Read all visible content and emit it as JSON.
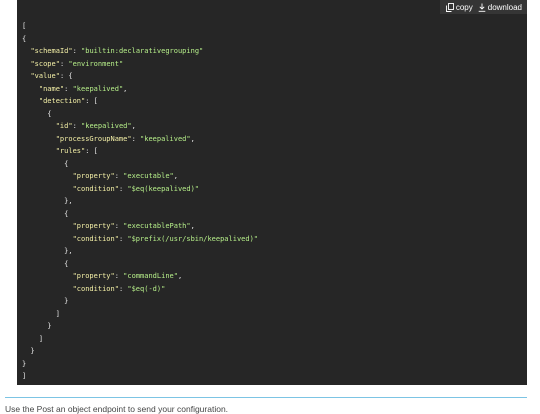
{
  "toolbar": {
    "copy_label": "copy",
    "download_label": "download",
    "copy_icon": "copy-icon",
    "download_icon": "download-icon"
  },
  "code_lines": [
    [
      {
        "t": "pun",
        "v": "["
      }
    ],
    [
      {
        "t": "pun",
        "v": "{"
      }
    ],
    [
      {
        "t": "pun",
        "v": "  "
      },
      {
        "t": "key",
        "v": "\"schemaId\""
      },
      {
        "t": "pun",
        "v": ": "
      },
      {
        "t": "str",
        "v": "\"builtin:declarativegrouping\""
      }
    ],
    [
      {
        "t": "pun",
        "v": "  "
      },
      {
        "t": "key",
        "v": "\"scope\""
      },
      {
        "t": "pun",
        "v": ": "
      },
      {
        "t": "str",
        "v": "\"environment\""
      }
    ],
    [
      {
        "t": "pun",
        "v": "  "
      },
      {
        "t": "key",
        "v": "\"value\""
      },
      {
        "t": "pun",
        "v": ": {"
      }
    ],
    [
      {
        "t": "pun",
        "v": "    "
      },
      {
        "t": "key",
        "v": "\"name\""
      },
      {
        "t": "pun",
        "v": ": "
      },
      {
        "t": "str",
        "v": "\"keepalived\""
      },
      {
        "t": "pun",
        "v": ","
      }
    ],
    [
      {
        "t": "pun",
        "v": "    "
      },
      {
        "t": "key",
        "v": "\"detection\""
      },
      {
        "t": "pun",
        "v": ": ["
      }
    ],
    [
      {
        "t": "pun",
        "v": "      {"
      }
    ],
    [
      {
        "t": "pun",
        "v": "        "
      },
      {
        "t": "key",
        "v": "\"id\""
      },
      {
        "t": "pun",
        "v": ": "
      },
      {
        "t": "str",
        "v": "\"keepalived\""
      },
      {
        "t": "pun",
        "v": ","
      }
    ],
    [
      {
        "t": "pun",
        "v": "        "
      },
      {
        "t": "key",
        "v": "\"processGroupName\""
      },
      {
        "t": "pun",
        "v": ": "
      },
      {
        "t": "str",
        "v": "\"keepalived\""
      },
      {
        "t": "pun",
        "v": ","
      }
    ],
    [
      {
        "t": "pun",
        "v": "        "
      },
      {
        "t": "key",
        "v": "\"rules\""
      },
      {
        "t": "pun",
        "v": ": ["
      }
    ],
    [
      {
        "t": "pun",
        "v": "          {"
      }
    ],
    [
      {
        "t": "pun",
        "v": "            "
      },
      {
        "t": "key",
        "v": "\"property\""
      },
      {
        "t": "pun",
        "v": ": "
      },
      {
        "t": "str",
        "v": "\"executable\""
      },
      {
        "t": "pun",
        "v": ","
      }
    ],
    [
      {
        "t": "pun",
        "v": "            "
      },
      {
        "t": "key",
        "v": "\"condition\""
      },
      {
        "t": "pun",
        "v": ": "
      },
      {
        "t": "str",
        "v": "\"$eq(keepalived)\""
      }
    ],
    [
      {
        "t": "pun",
        "v": "          },"
      }
    ],
    [
      {
        "t": "pun",
        "v": "          {"
      }
    ],
    [
      {
        "t": "pun",
        "v": "            "
      },
      {
        "t": "key",
        "v": "\"property\""
      },
      {
        "t": "pun",
        "v": ": "
      },
      {
        "t": "str",
        "v": "\"executablePath\""
      },
      {
        "t": "pun",
        "v": ","
      }
    ],
    [
      {
        "t": "pun",
        "v": "            "
      },
      {
        "t": "key",
        "v": "\"condition\""
      },
      {
        "t": "pun",
        "v": ": "
      },
      {
        "t": "str",
        "v": "\"$prefix(/usr/sbin/keepalived)\""
      }
    ],
    [
      {
        "t": "pun",
        "v": "          },"
      }
    ],
    [
      {
        "t": "pun",
        "v": "          {"
      }
    ],
    [
      {
        "t": "pun",
        "v": "            "
      },
      {
        "t": "key",
        "v": "\"property\""
      },
      {
        "t": "pun",
        "v": ": "
      },
      {
        "t": "str",
        "v": "\"commandLine\""
      },
      {
        "t": "pun",
        "v": ","
      }
    ],
    [
      {
        "t": "pun",
        "v": "            "
      },
      {
        "t": "key",
        "v": "\"condition\""
      },
      {
        "t": "pun",
        "v": ": "
      },
      {
        "t": "str",
        "v": "\"$eq(-d)\""
      }
    ],
    [
      {
        "t": "pun",
        "v": "          }"
      }
    ],
    [
      {
        "t": "pun",
        "v": "        ]"
      }
    ],
    [
      {
        "t": "pun",
        "v": "      }"
      }
    ],
    [
      {
        "t": "pun",
        "v": "    ]"
      }
    ],
    [
      {
        "t": "pun",
        "v": "  }"
      }
    ],
    [
      {
        "t": "pun",
        "v": "}"
      }
    ],
    [
      {
        "t": "pun",
        "v": "]"
      }
    ]
  ],
  "caption": "Use the Post an object endpoint to send your configuration.",
  "colors": {
    "code_bg": "#262626",
    "toolbar_bg": "#353535",
    "key": "#f6f2a8",
    "string": "#b7f08a",
    "divider": "#7cc4e4"
  }
}
